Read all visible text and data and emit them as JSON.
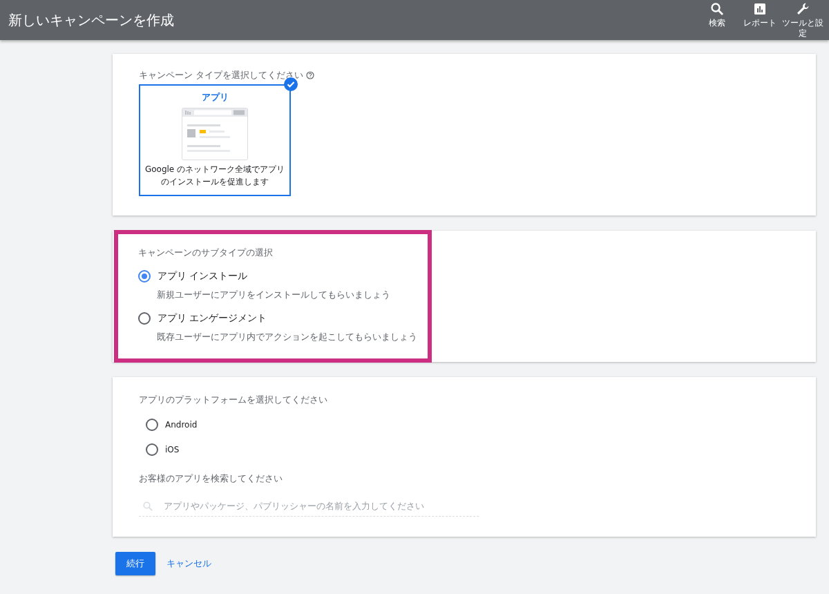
{
  "header": {
    "title": "新しいキャンペーンを作成",
    "actions": [
      {
        "label": "検索",
        "kind": "search"
      },
      {
        "label": "レポート",
        "kind": "report"
      },
      {
        "label": "ツールと設定",
        "kind": "tools"
      }
    ]
  },
  "campaign_type": {
    "label": "キャンペーン タイプを選択してください",
    "options": [
      {
        "title": "アプリ",
        "description": "Google のネットワーク全域でアプリのインストールを促進します",
        "selected": true
      }
    ]
  },
  "subtype": {
    "label": "キャンペーンのサブタイプの選択",
    "options": [
      {
        "title": "アプリ インストール",
        "description": "新規ユーザーにアプリをインストールしてもらいましょう",
        "selected": true
      },
      {
        "title": "アプリ エンゲージメント",
        "description": "既存ユーザーにアプリ内でアクションを起こしてもらいましょう",
        "selected": false
      }
    ]
  },
  "platform": {
    "label": "アプリのプラットフォームを選択してください",
    "options": [
      {
        "label": "Android",
        "selected": false
      },
      {
        "label": "iOS",
        "selected": false
      }
    ]
  },
  "app_search": {
    "label": "お客様のアプリを検索してください",
    "placeholder": "アプリやパッケージ、パブリッシャーの名前を入力してください"
  },
  "buttons": [
    {
      "label": "続行",
      "kind": "primary"
    },
    {
      "label": "キャンセル",
      "kind": "link"
    }
  ]
}
